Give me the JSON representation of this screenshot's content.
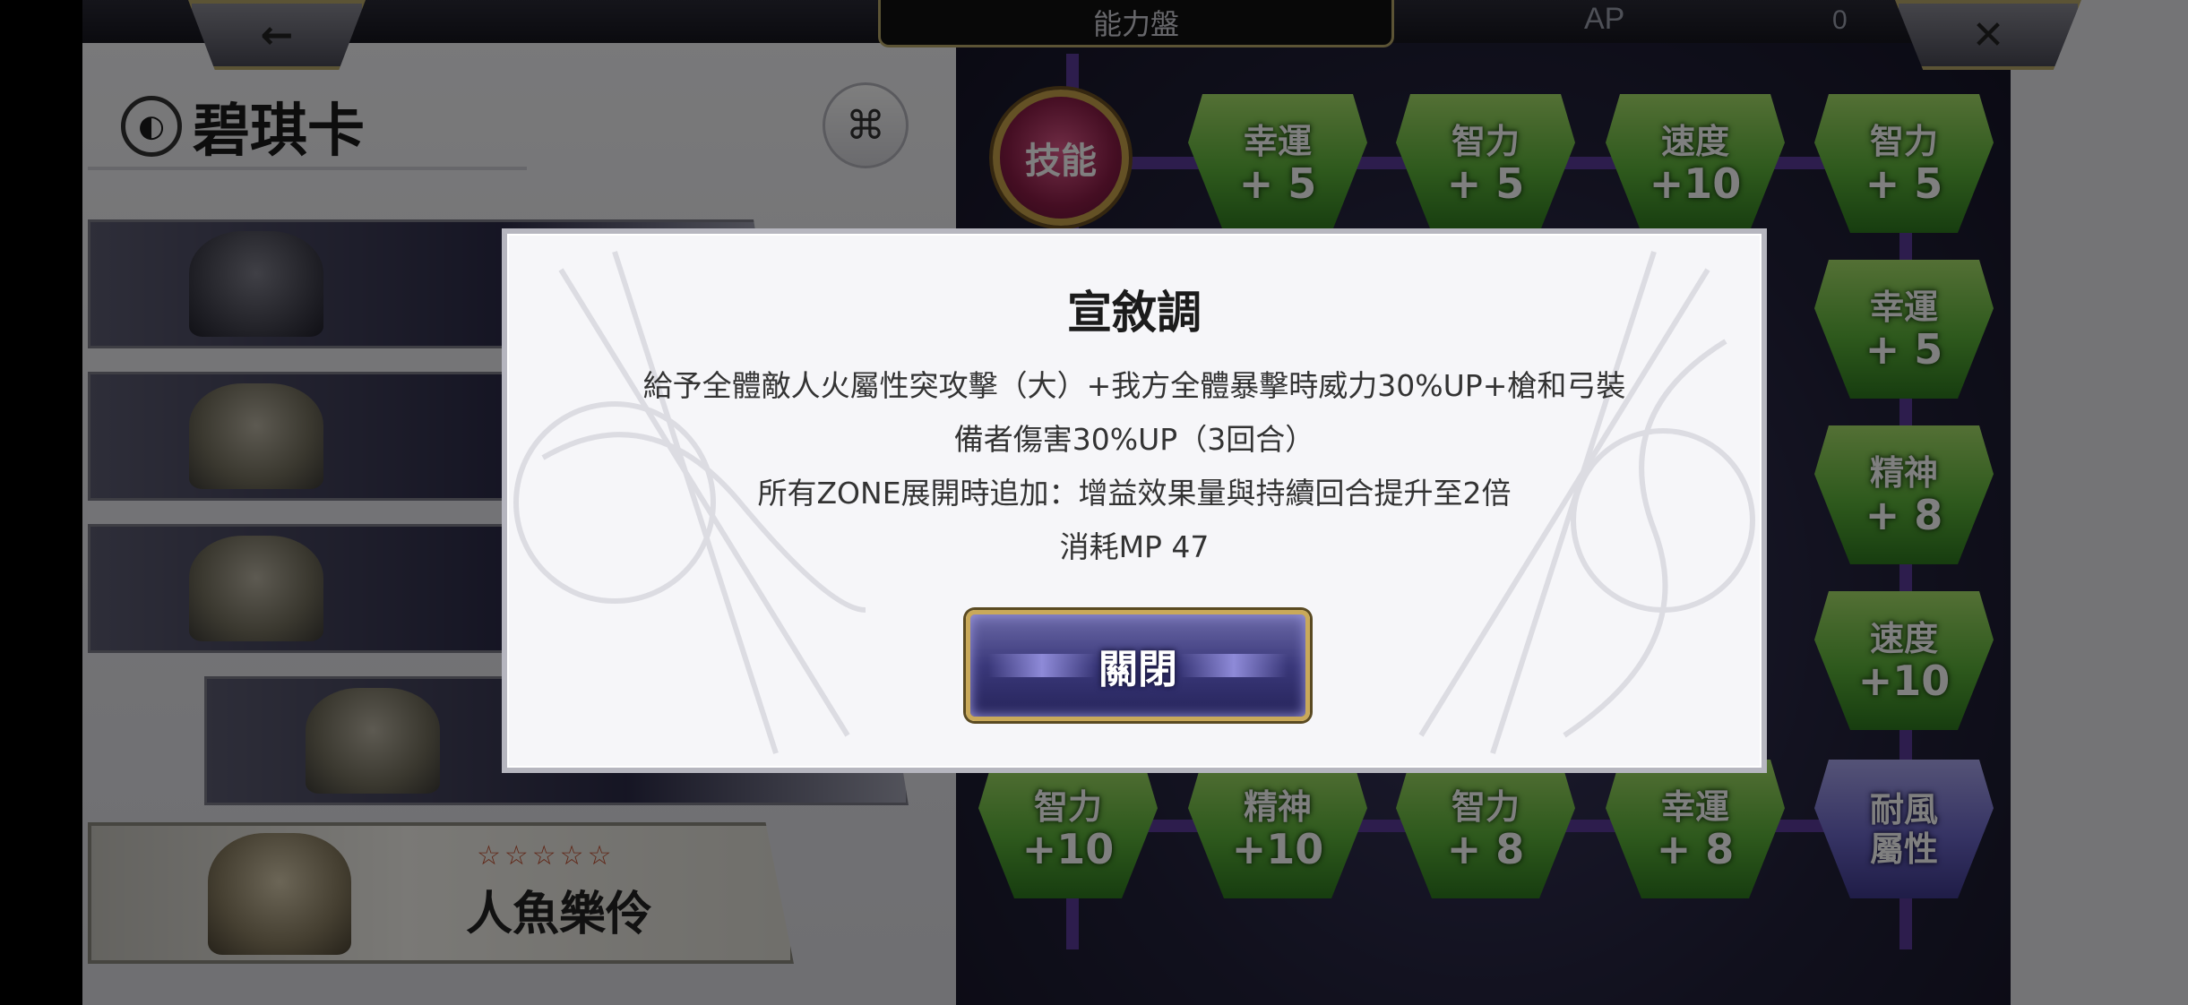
{
  "header": {
    "back_icon": "←",
    "title": "能力盤",
    "ap_label": "AP",
    "ap_value": "0",
    "close_icon": "✕"
  },
  "character": {
    "name": "碧琪卡",
    "link_icon": "⌘"
  },
  "card_list": {
    "last_card_stars": "☆☆☆☆☆",
    "last_card_name": "人魚樂伶"
  },
  "ability_board": {
    "skill_node_label": "技能",
    "gems": [
      {
        "stat": "幸運",
        "val": "+ 5"
      },
      {
        "stat": "智力",
        "val": "+ 5"
      },
      {
        "stat": "速度",
        "val": "+10"
      },
      {
        "stat": "智力",
        "val": "+ 5"
      },
      {
        "stat": "幸運",
        "val": "+ 5"
      },
      {
        "stat": "精神",
        "val": "+ 8"
      },
      {
        "stat": "速度",
        "val": "+10"
      },
      {
        "stat": "智力",
        "val": "+10"
      },
      {
        "stat": "精神",
        "val": "+10"
      },
      {
        "stat": "智力",
        "val": "+ 8"
      },
      {
        "stat": "幸運",
        "val": "+ 8"
      },
      {
        "stat": "耐風",
        "val": "屬性"
      }
    ]
  },
  "dialog": {
    "title": "宣敘調",
    "lines": [
      "給予全體敵人火屬性突攻擊（大）+我方全體暴擊時威力30%UP+槍和弓裝",
      "備者傷害30%UP（3回合）",
      "所有ZONE展開時追加：增益效果量與持續回合提升至2倍",
      "消耗MP 47"
    ],
    "close_button": "關閉"
  },
  "colors": {
    "gem_green": "#5db33a",
    "gem_purple": "#6c67c8",
    "button_border_gold": "#c9a95a",
    "button_fill": "#3a387a"
  }
}
